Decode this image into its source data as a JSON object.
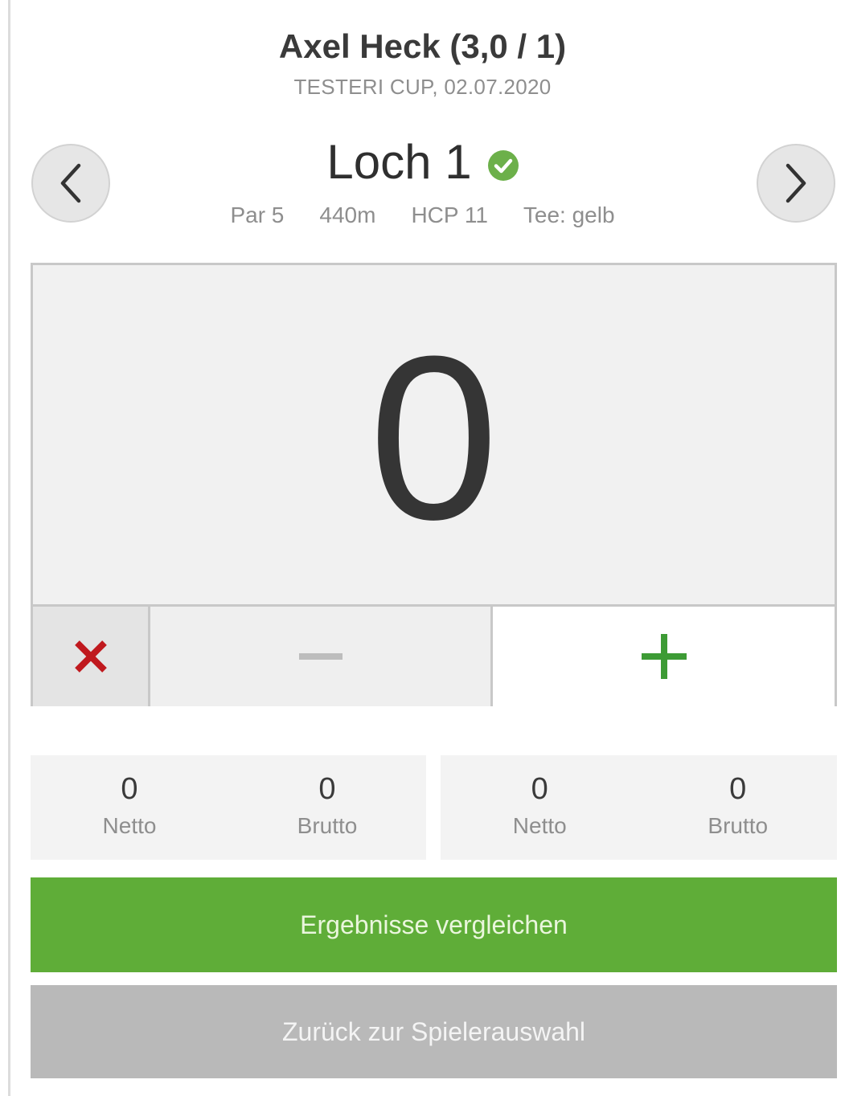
{
  "player": {
    "title": "Axel Heck (3,0 / 1)",
    "subtitle": "TESTERI CUP, 02.07.2020"
  },
  "hole": {
    "title": "Loch 1",
    "status_icon": "check-circle-icon",
    "par": "Par 5",
    "distance": "440m",
    "hcp": "HCP 11",
    "tee": "Tee: gelb"
  },
  "navigation": {
    "prev_icon": "chevron-left-icon",
    "next_icon": "chevron-right-icon"
  },
  "score": {
    "value": "0"
  },
  "controls": {
    "clear_icon": "close-icon",
    "minus_icon": "minus-icon",
    "plus_icon": "plus-icon"
  },
  "stats": {
    "left": [
      {
        "value": "0",
        "label": "Netto"
      },
      {
        "value": "0",
        "label": "Brutto"
      }
    ],
    "right": [
      {
        "value": "0",
        "label": "Netto"
      },
      {
        "value": "0",
        "label": "Brutto"
      }
    ]
  },
  "buttons": {
    "compare_label": "Ergebnisse vergleichen",
    "back_label": "Zurück zur Spielerauswahl"
  },
  "colors": {
    "accent_green": "#5fad38",
    "check_green": "#6cb04a",
    "clear_red": "#c0191e",
    "plus_green": "#3d9b35",
    "minus_gray": "#bdbdbd",
    "disabled_gray": "#b9b9b9"
  }
}
